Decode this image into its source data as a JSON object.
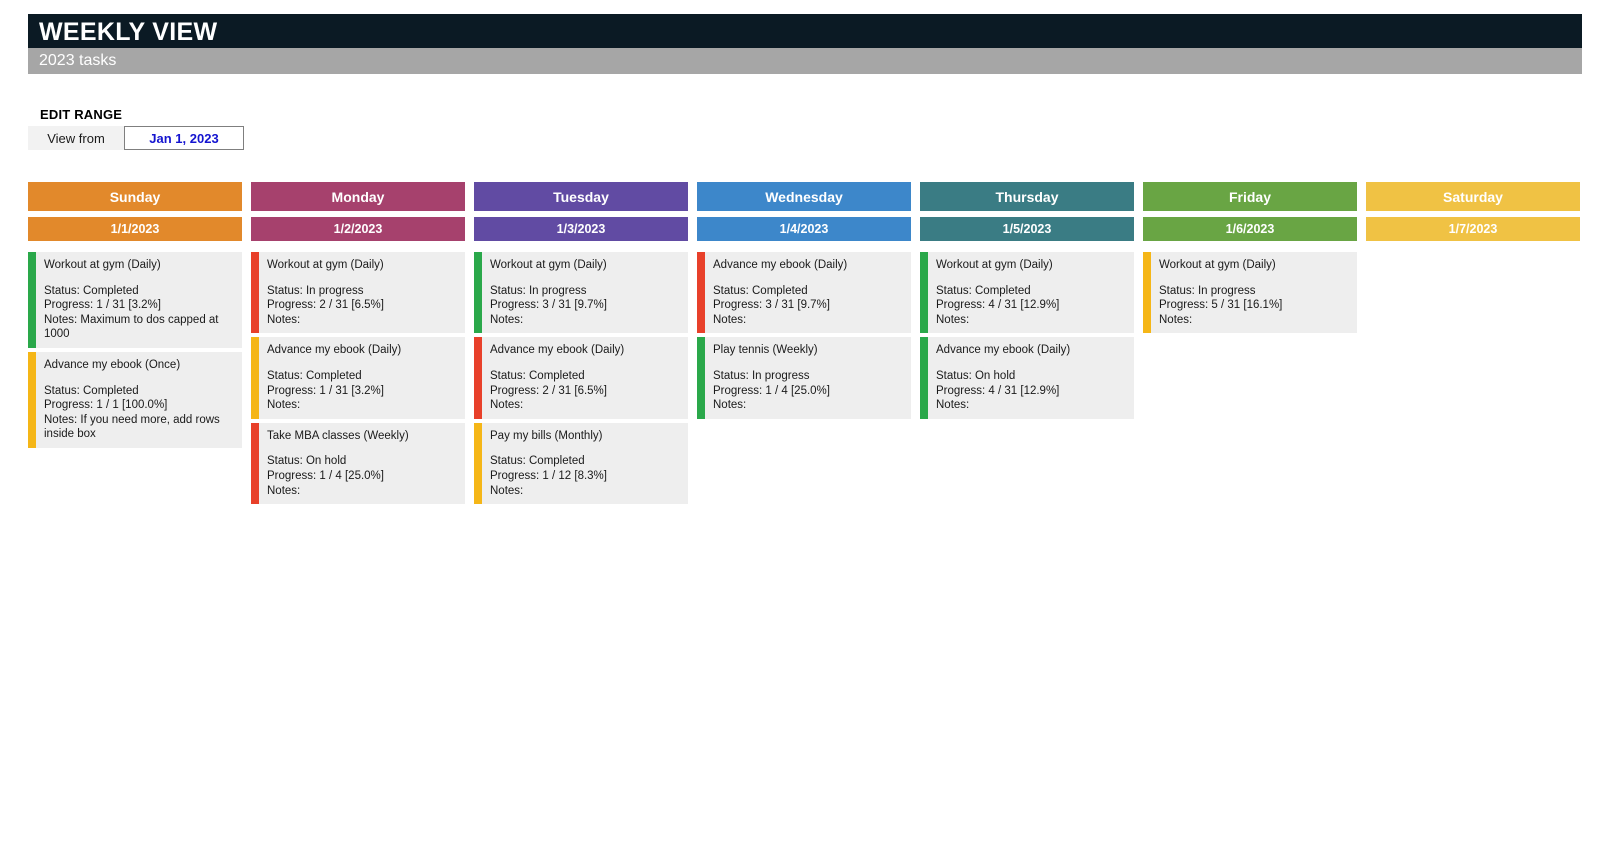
{
  "header": {
    "title": "WEEKLY VIEW",
    "subtitle": "2023 tasks",
    "title_bg": "#0b1a24",
    "subtitle_bg": "#a6a6a6"
  },
  "edit_range": {
    "section_label": "EDIT RANGE",
    "view_from_label": "View from",
    "date_value": "Jan 1, 2023",
    "date_text_color": "#1414d0"
  },
  "status_colors": {
    "green": "#2aa84a",
    "red": "#e8402a",
    "yellow": "#f5b617"
  },
  "days": [
    {
      "name": "Sunday",
      "date": "1/1/2023",
      "color": "#e2892b",
      "tasks": [
        {
          "accent": "#2aa84a",
          "title": "Workout at gym (Daily)",
          "status": "Status: Completed",
          "progress": "Progress: 1 / 31  [3.2%]",
          "notes": "Notes: Maximum to dos capped at 1000"
        },
        {
          "accent": "#f5b617",
          "title": "Advance my ebook (Once)",
          "status": "Status: Completed",
          "progress": "Progress: 1 / 1  [100.0%]",
          "notes": "Notes: If you need more, add rows inside box"
        }
      ]
    },
    {
      "name": "Monday",
      "date": "1/2/2023",
      "color": "#a6416d",
      "tasks": [
        {
          "accent": "#e8402a",
          "title": "Workout at gym (Daily)",
          "status": "Status: In progress",
          "progress": "Progress: 2 / 31  [6.5%]",
          "notes": "Notes:"
        },
        {
          "accent": "#f5b617",
          "title": "Advance my ebook (Daily)",
          "status": "Status: Completed",
          "progress": "Progress: 1 / 31  [3.2%]",
          "notes": "Notes:"
        },
        {
          "accent": "#e8402a",
          "title": "Take MBA classes (Weekly)",
          "status": "Status: On hold",
          "progress": "Progress: 1 / 4  [25.0%]",
          "notes": "Notes:"
        }
      ]
    },
    {
      "name": "Tuesday",
      "date": "1/3/2023",
      "color": "#614ba3",
      "tasks": [
        {
          "accent": "#2aa84a",
          "title": "Workout at gym (Daily)",
          "status": "Status: In progress",
          "progress": "Progress: 3 / 31  [9.7%]",
          "notes": "Notes:"
        },
        {
          "accent": "#e8402a",
          "title": "Advance my ebook (Daily)",
          "status": "Status: Completed",
          "progress": "Progress: 2 / 31  [6.5%]",
          "notes": "Notes:"
        },
        {
          "accent": "#f5b617",
          "title": "Pay my bills (Monthly)",
          "status": "Status: Completed",
          "progress": "Progress: 1 / 12  [8.3%]",
          "notes": "Notes:"
        }
      ]
    },
    {
      "name": "Wednesday",
      "date": "1/4/2023",
      "color": "#3d87ca",
      "tasks": [
        {
          "accent": "#e8402a",
          "title": "Advance my ebook (Daily)",
          "status": "Status: Completed",
          "progress": "Progress: 3 / 31  [9.7%]",
          "notes": "Notes:"
        },
        {
          "accent": "#2aa84a",
          "title": "Play tennis (Weekly)",
          "status": "Status: In progress",
          "progress": "Progress: 1 / 4  [25.0%]",
          "notes": "Notes:"
        }
      ]
    },
    {
      "name": "Thursday",
      "date": "1/5/2023",
      "color": "#3a7c84",
      "tasks": [
        {
          "accent": "#2aa84a",
          "title": "Workout at gym (Daily)",
          "status": "Status: Completed",
          "progress": "Progress: 4 / 31  [12.9%]",
          "notes": "Notes:"
        },
        {
          "accent": "#2aa84a",
          "title": "Advance my ebook (Daily)",
          "status": "Status: On hold",
          "progress": "Progress: 4 / 31  [12.9%]",
          "notes": "Notes:"
        }
      ]
    },
    {
      "name": "Friday",
      "date": "1/6/2023",
      "color": "#69a544",
      "tasks": [
        {
          "accent": "#f5b617",
          "title": "Workout at gym (Daily)",
          "status": "Status: In progress",
          "progress": "Progress: 5 / 31  [16.1%]",
          "notes": "Notes:"
        }
      ]
    },
    {
      "name": "Saturday",
      "date": "1/7/2023",
      "color": "#f0c244",
      "tasks": []
    }
  ]
}
